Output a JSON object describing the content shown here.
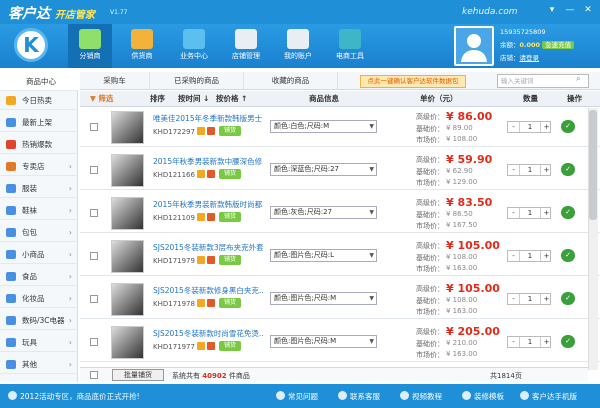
{
  "app": {
    "name": "客户达",
    "subtitle": "开店管家",
    "version": "V1.77",
    "brand": "kehuda.com"
  },
  "toolbar": [
    {
      "label": "分销商",
      "active": true,
      "color": "#8fe06a"
    },
    {
      "label": "供货商",
      "color": "#f2b33a"
    },
    {
      "label": "业务中心",
      "color": "#5bc0f0"
    },
    {
      "label": "店铺管理",
      "color": "#e8eef4"
    },
    {
      "label": "我的账户",
      "color": "#e8eef4"
    },
    {
      "label": "电商工具",
      "color": "#3fb6c8"
    }
  ],
  "account": {
    "phone": "15935725809",
    "balance_label": "余额：",
    "balance": "0.000",
    "recharge": "急速充值",
    "shop_label": "店铺：",
    "shop": "请登录"
  },
  "nav": {
    "header": "商品中心",
    "items": [
      {
        "label": "今日热卖",
        "color": "#f5a623"
      },
      {
        "label": "最新上架",
        "color": "#4a90e2"
      },
      {
        "label": "热销爆款",
        "color": "#e0442a"
      },
      {
        "label": "专卖店",
        "color": "#e07a2a"
      },
      {
        "label": "服装",
        "color": "#4a90e2"
      },
      {
        "label": "鞋袜",
        "color": "#4a90e2"
      },
      {
        "label": "包包",
        "color": "#4a90e2"
      },
      {
        "label": "小商品",
        "color": "#4a90e2"
      },
      {
        "label": "食品",
        "color": "#4a90e2"
      },
      {
        "label": "化妆品",
        "color": "#4a90e2"
      },
      {
        "label": "数码/3C电器",
        "color": "#4a90e2"
      },
      {
        "label": "玩具",
        "color": "#4a90e2"
      },
      {
        "label": "其他",
        "color": "#4a90e2"
      }
    ]
  },
  "tabs": [
    "采购车",
    "已采购的商品",
    "收藏的商品"
  ],
  "promo": "点此一键确认客户达软件数据包",
  "search_placeholder": "输入关键词",
  "table": {
    "headers": {
      "filter": "筛选",
      "sort": "排序",
      "time": "按时间",
      "price": "按价格",
      "info": "商品信息",
      "unit_price": "单价（元）",
      "qty": "数量",
      "op": "操作"
    },
    "labels": {
      "high": "高级价：",
      "base": "基础价：",
      "market": "市场价："
    },
    "publish": "铺货",
    "rows": [
      {
        "name": "唯美佳2015年冬季新款韩版男士...",
        "code": "KHD172297",
        "spec": "颜色:白色;尺码:M",
        "high": "¥ 86.00",
        "base": "¥ 89.00",
        "market": "¥ 108.00",
        "qty": "1"
      },
      {
        "name": "2015年秋季男装新款中腰深色修...",
        "code": "KHD121166",
        "spec": "颜色:深蓝色;尺码:27",
        "high": "¥ 59.90",
        "base": "¥ 62.90",
        "market": "¥ 129.00",
        "qty": "1"
      },
      {
        "name": "2015年秋季男装新款韩版时尚都...",
        "code": "KHD121109",
        "spec": "颜色:灰色;尺码:27",
        "high": "¥ 83.50",
        "base": "¥ 86.50",
        "market": "¥ 167.50",
        "qty": "1"
      },
      {
        "name": "SJS2015冬装新款3层布夹克外套...",
        "code": "KHD171979",
        "spec": "颜色:图片色;尺码:L",
        "high": "¥ 105.00",
        "base": "¥ 108.00",
        "market": "¥ 163.00",
        "qty": "1"
      },
      {
        "name": "SJS2015冬装新款修身黑白夹克...",
        "code": "KHD171978",
        "spec": "颜色:图片色;尺码:M",
        "high": "¥ 105.00",
        "base": "¥ 108.00",
        "market": "¥ 163.00",
        "qty": "1"
      },
      {
        "name": "SJS2015冬装新款时尚雪花免烫...",
        "code": "KHD171977",
        "spec": "颜色:图片色;尺码:M",
        "high": "¥ 205.00",
        "base": "¥ 210.00",
        "market": "¥ 163.00",
        "qty": "1"
      }
    ]
  },
  "footer": {
    "batch": "批量铺货",
    "total_pre": "系统共有",
    "total": "40902",
    "total_post": "件商品",
    "page": "共1814页"
  },
  "status": {
    "notice": "2012活动专区，商品底价正式开抢!",
    "items": [
      "常见问题",
      "联系客服",
      "视频教程",
      "装修模板",
      "客户达手机版"
    ]
  }
}
